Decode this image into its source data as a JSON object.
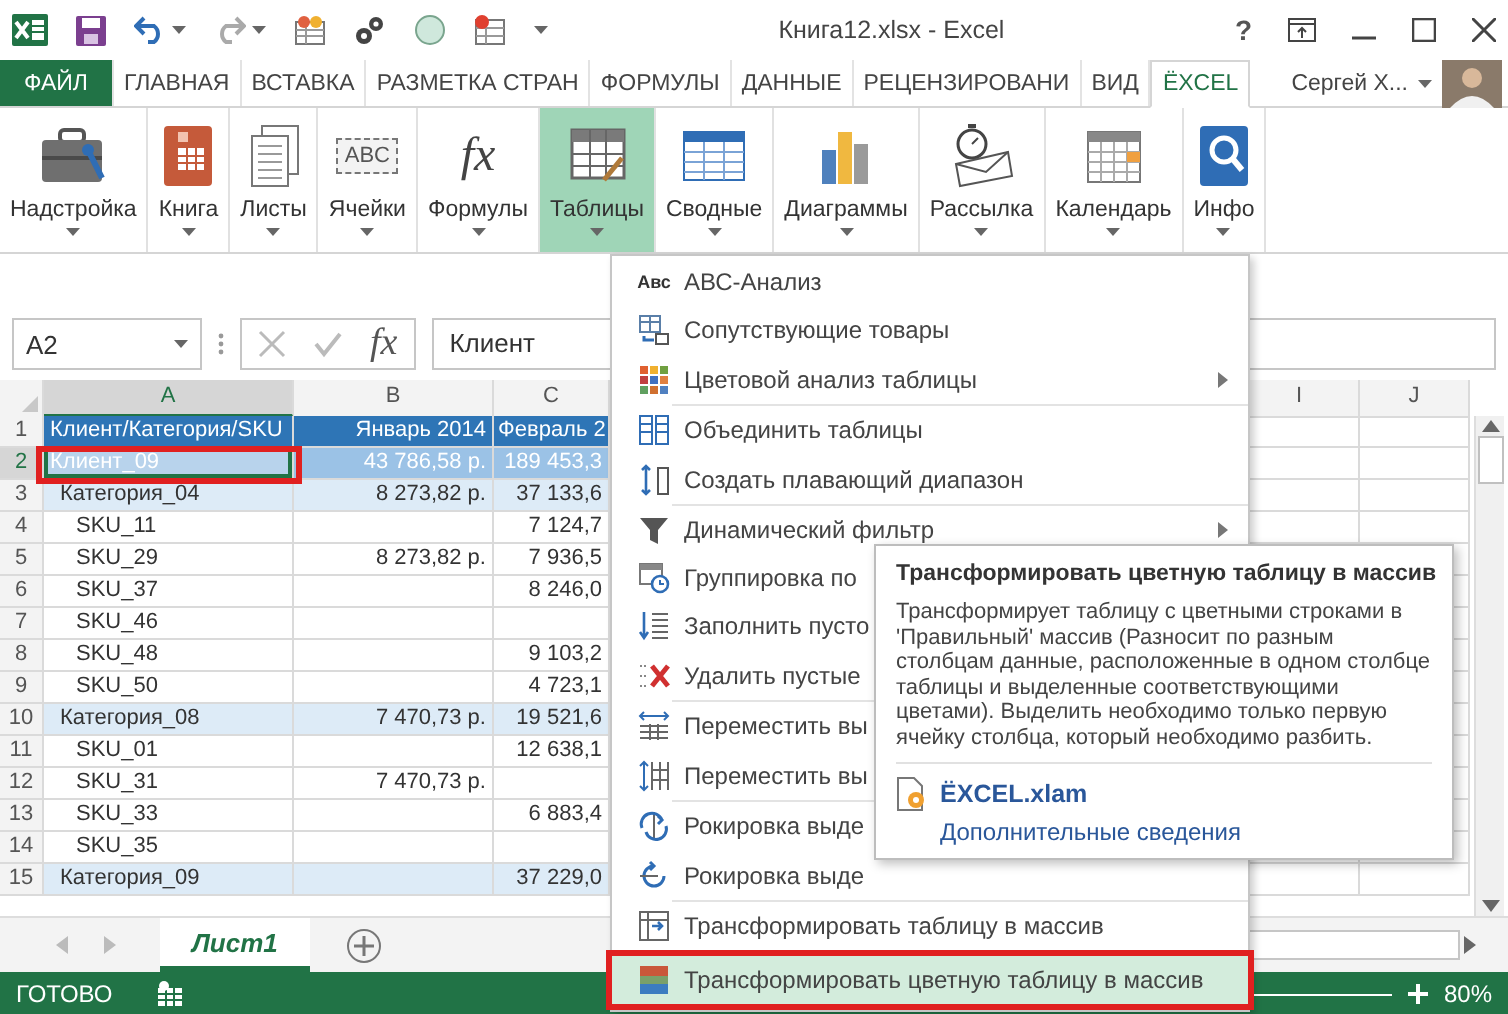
{
  "title_bar": {
    "title": "Книга12.xlsx - Excel",
    "help": "?"
  },
  "tabs": [
    {
      "label": "ФАЙЛ",
      "kind": "file",
      "selected": false
    },
    {
      "label": "ГЛАВНАЯ",
      "kind": "tab",
      "selected": false
    },
    {
      "label": "ВСТАВКА",
      "kind": "tab",
      "selected": false
    },
    {
      "label": "РАЗМЕТКА СТРАН",
      "kind": "tab",
      "selected": false
    },
    {
      "label": "ФОРМУЛЫ",
      "kind": "tab",
      "selected": false
    },
    {
      "label": "ДАННЫЕ",
      "kind": "tab",
      "selected": false
    },
    {
      "label": "РЕЦЕНЗИРОВАНИ",
      "kind": "tab",
      "selected": false
    },
    {
      "label": "ВИД",
      "kind": "tab",
      "selected": false
    },
    {
      "label": "ЁXCEL",
      "kind": "tab",
      "selected": true
    }
  ],
  "account": {
    "name": "Сергей Х..."
  },
  "ribbon": [
    {
      "label": "Надстройка",
      "selected": false
    },
    {
      "label": "Книга",
      "selected": false
    },
    {
      "label": "Листы",
      "selected": false
    },
    {
      "label": "Ячейки",
      "icon_text": "ABC",
      "selected": false
    },
    {
      "label": "Формулы",
      "icon_text": "fx",
      "selected": false
    },
    {
      "label": "Таблицы",
      "selected": true
    },
    {
      "label": "Сводные",
      "selected": false
    },
    {
      "label": "Диаграммы",
      "selected": false
    },
    {
      "label": "Рассылка",
      "selected": false
    },
    {
      "label": "Календарь",
      "selected": false
    },
    {
      "label": "Инфо",
      "selected": false
    }
  ],
  "formula_bar": {
    "name_box": "A2",
    "function_button": "fx",
    "value": "Клиент"
  },
  "columns": [
    {
      "label": "A",
      "selected": true
    },
    {
      "label": "B",
      "selected": false
    },
    {
      "label": "C",
      "selected": false
    },
    {
      "label": "I",
      "selected": false
    },
    {
      "label": "J",
      "selected": false
    }
  ],
  "rows": [
    {
      "number": "1",
      "kind": "header",
      "selected": false,
      "annotated": false,
      "cells": {
        "A": "Клиент/Категория/SKU",
        "B": "Январь 2014",
        "C": "Февраль 2"
      }
    },
    {
      "number": "2",
      "kind": "client",
      "selected": true,
      "annotated": true,
      "cells": {
        "A": "Клиент_09",
        "B": "43 786,58 р.",
        "C": "189 453,3"
      }
    },
    {
      "number": "3",
      "kind": "category",
      "selected": false,
      "annotated": false,
      "cells": {
        "A": "Категория_04",
        "B": "8 273,82 р.",
        "C": "37 133,6"
      }
    },
    {
      "number": "4",
      "kind": "sku",
      "selected": false,
      "annotated": false,
      "cells": {
        "A": "SKU_11",
        "C": "7 124,7"
      }
    },
    {
      "number": "5",
      "kind": "sku",
      "selected": false,
      "annotated": false,
      "cells": {
        "A": "SKU_29",
        "B": "8 273,82 р.",
        "C": "7 936,5"
      }
    },
    {
      "number": "6",
      "kind": "sku",
      "selected": false,
      "annotated": false,
      "cells": {
        "A": "SKU_37",
        "C": "8 246,0"
      }
    },
    {
      "number": "7",
      "kind": "sku",
      "selected": false,
      "annotated": false,
      "cells": {
        "A": "SKU_46"
      }
    },
    {
      "number": "8",
      "kind": "sku",
      "selected": false,
      "annotated": false,
      "cells": {
        "A": "SKU_48",
        "C": "9 103,2"
      }
    },
    {
      "number": "9",
      "kind": "sku",
      "selected": false,
      "annotated": false,
      "cells": {
        "A": "SKU_50",
        "C": "4 723,1"
      }
    },
    {
      "number": "10",
      "kind": "category",
      "selected": false,
      "annotated": false,
      "cells": {
        "A": "Категория_08",
        "B": "7 470,73 р.",
        "C": "19 521,6"
      }
    },
    {
      "number": "11",
      "kind": "sku",
      "selected": false,
      "annotated": false,
      "cells": {
        "A": "SKU_01",
        "C": "12 638,1"
      }
    },
    {
      "number": "12",
      "kind": "sku",
      "selected": false,
      "annotated": false,
      "cells": {
        "A": "SKU_31",
        "B": "7 470,73 р."
      }
    },
    {
      "number": "13",
      "kind": "sku",
      "selected": false,
      "annotated": false,
      "cells": {
        "A": "SKU_33",
        "C": "6 883,4"
      }
    },
    {
      "number": "14",
      "kind": "sku",
      "selected": false,
      "annotated": false,
      "cells": {
        "A": "SKU_35"
      }
    },
    {
      "number": "15",
      "kind": "category",
      "selected": false,
      "annotated": false,
      "cells": {
        "A": "Категория_09",
        "C": "37 229,0"
      }
    }
  ],
  "menu": [
    {
      "label": "АВС-Анализ",
      "icon_text": "Авс",
      "submenu": false,
      "separator_after": false,
      "hovered": false,
      "annotated": false
    },
    {
      "label": "Сопутствующие товары",
      "submenu": false,
      "separator_after": false,
      "hovered": false,
      "annotated": false
    },
    {
      "label": "Цветовой анализ таблицы",
      "submenu": true,
      "separator_after": true,
      "hovered": false,
      "annotated": false
    },
    {
      "label": "Объединить таблицы",
      "submenu": false,
      "separator_after": false,
      "hovered": false,
      "annotated": false
    },
    {
      "label": "Создать плавающий диапазон",
      "submenu": false,
      "separator_after": true,
      "hovered": false,
      "annotated": false
    },
    {
      "label": "Динамический фильтр",
      "submenu": true,
      "separator_after": false,
      "hovered": false,
      "annotated": false
    },
    {
      "label": "Группировка по",
      "separator_after": false,
      "hovered": false,
      "annotated": false
    },
    {
      "label": "Заполнить пусто",
      "separator_after": false,
      "hovered": false,
      "annotated": false
    },
    {
      "label": "Удалить пустые",
      "separator_after": true,
      "hovered": false,
      "annotated": false
    },
    {
      "label": "Переместить вы",
      "separator_after": false,
      "hovered": false,
      "annotated": false
    },
    {
      "label": "Переместить вы",
      "separator_after": true,
      "hovered": false,
      "annotated": false
    },
    {
      "label": "Рокировка выде",
      "separator_after": false,
      "hovered": false,
      "annotated": false
    },
    {
      "label": "Рокировка выде",
      "separator_after": true,
      "hovered": false,
      "annotated": false
    },
    {
      "label": "Трансформировать таблицу в массив",
      "submenu": false,
      "separator_after": false,
      "hovered": false,
      "annotated": false
    },
    {
      "label": "Трансформировать цветную таблицу в массив",
      "submenu": false,
      "separator_after": false,
      "hovered": true,
      "annotated": true
    }
  ],
  "tooltip": {
    "title": "Трансформировать цветную таблицу в массив",
    "body": "Трансформирует таблицу с цветными строками в 'Правильный' массив (Разносит по разным столбцам данные, расположенные в одном столбце таблицы и выделенные соответствующими цветами). Выделить необходимо только первую ячейку столбца, который необходимо разбить.",
    "addin": "ЁXCEL.xlam",
    "link": "Дополнительные сведения"
  },
  "sheet_tabs": [
    {
      "label": "Лист1",
      "selected": true
    }
  ],
  "status_bar": {
    "status": "ГОТОВО",
    "zoom": "80%"
  }
}
